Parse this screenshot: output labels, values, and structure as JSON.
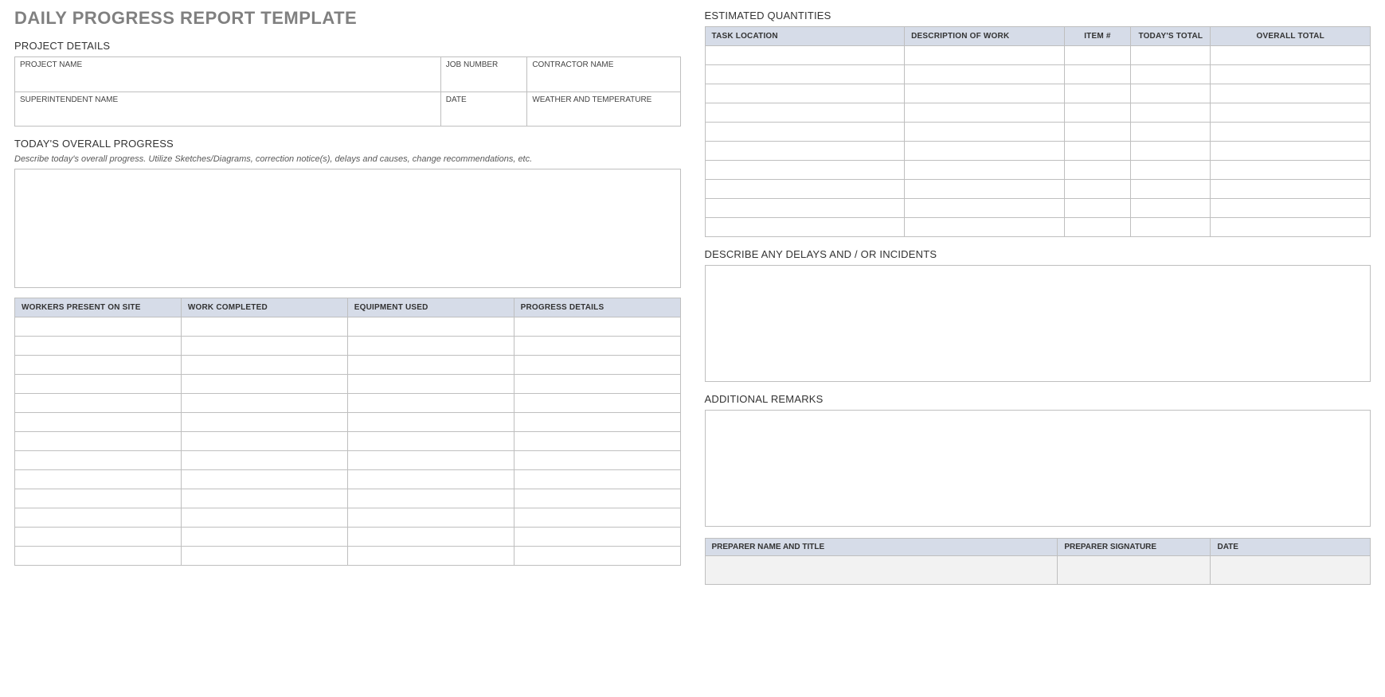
{
  "title": "DAILY PROGRESS REPORT TEMPLATE",
  "sections": {
    "project_details": {
      "heading": "PROJECT DETAILS",
      "fields": {
        "project_name": {
          "label": "PROJECT NAME",
          "value": ""
        },
        "job_number": {
          "label": "JOB NUMBER",
          "value": ""
        },
        "contractor": {
          "label": "CONTRACTOR NAME",
          "value": ""
        },
        "superintendent": {
          "label": "SUPERINTENDENT NAME",
          "value": ""
        },
        "date": {
          "label": "DATE",
          "value": ""
        },
        "weather": {
          "label": "WEATHER AND TEMPERATURE",
          "value": ""
        }
      }
    },
    "overall_progress": {
      "heading": "TODAY'S OVERALL PROGRESS",
      "instruction": "Describe today's overall progress.  Utilize Sketches/Diagrams, correction notice(s), delays and causes, change recommendations, etc.",
      "value": ""
    },
    "progress_table": {
      "headers": [
        "WORKERS PRESENT ON SITE",
        "WORK COMPLETED",
        "EQUIPMENT USED",
        "PROGRESS DETAILS"
      ],
      "row_count": 13
    },
    "quantities": {
      "heading": "ESTIMATED QUANTITIES",
      "headers": [
        "TASK LOCATION",
        "DESCRIPTION OF WORK",
        "ITEM #",
        "TODAY'S TOTAL",
        "OVERALL TOTAL"
      ],
      "row_count": 10
    },
    "delays": {
      "heading": "DESCRIBE ANY DELAYS AND / OR INCIDENTS",
      "value": ""
    },
    "remarks": {
      "heading": "ADDITIONAL REMARKS",
      "value": ""
    },
    "preparer": {
      "headers": [
        "PREPARER NAME AND TITLE",
        "PREPARER SIGNATURE",
        "DATE"
      ],
      "values": [
        "",
        "",
        ""
      ]
    }
  }
}
